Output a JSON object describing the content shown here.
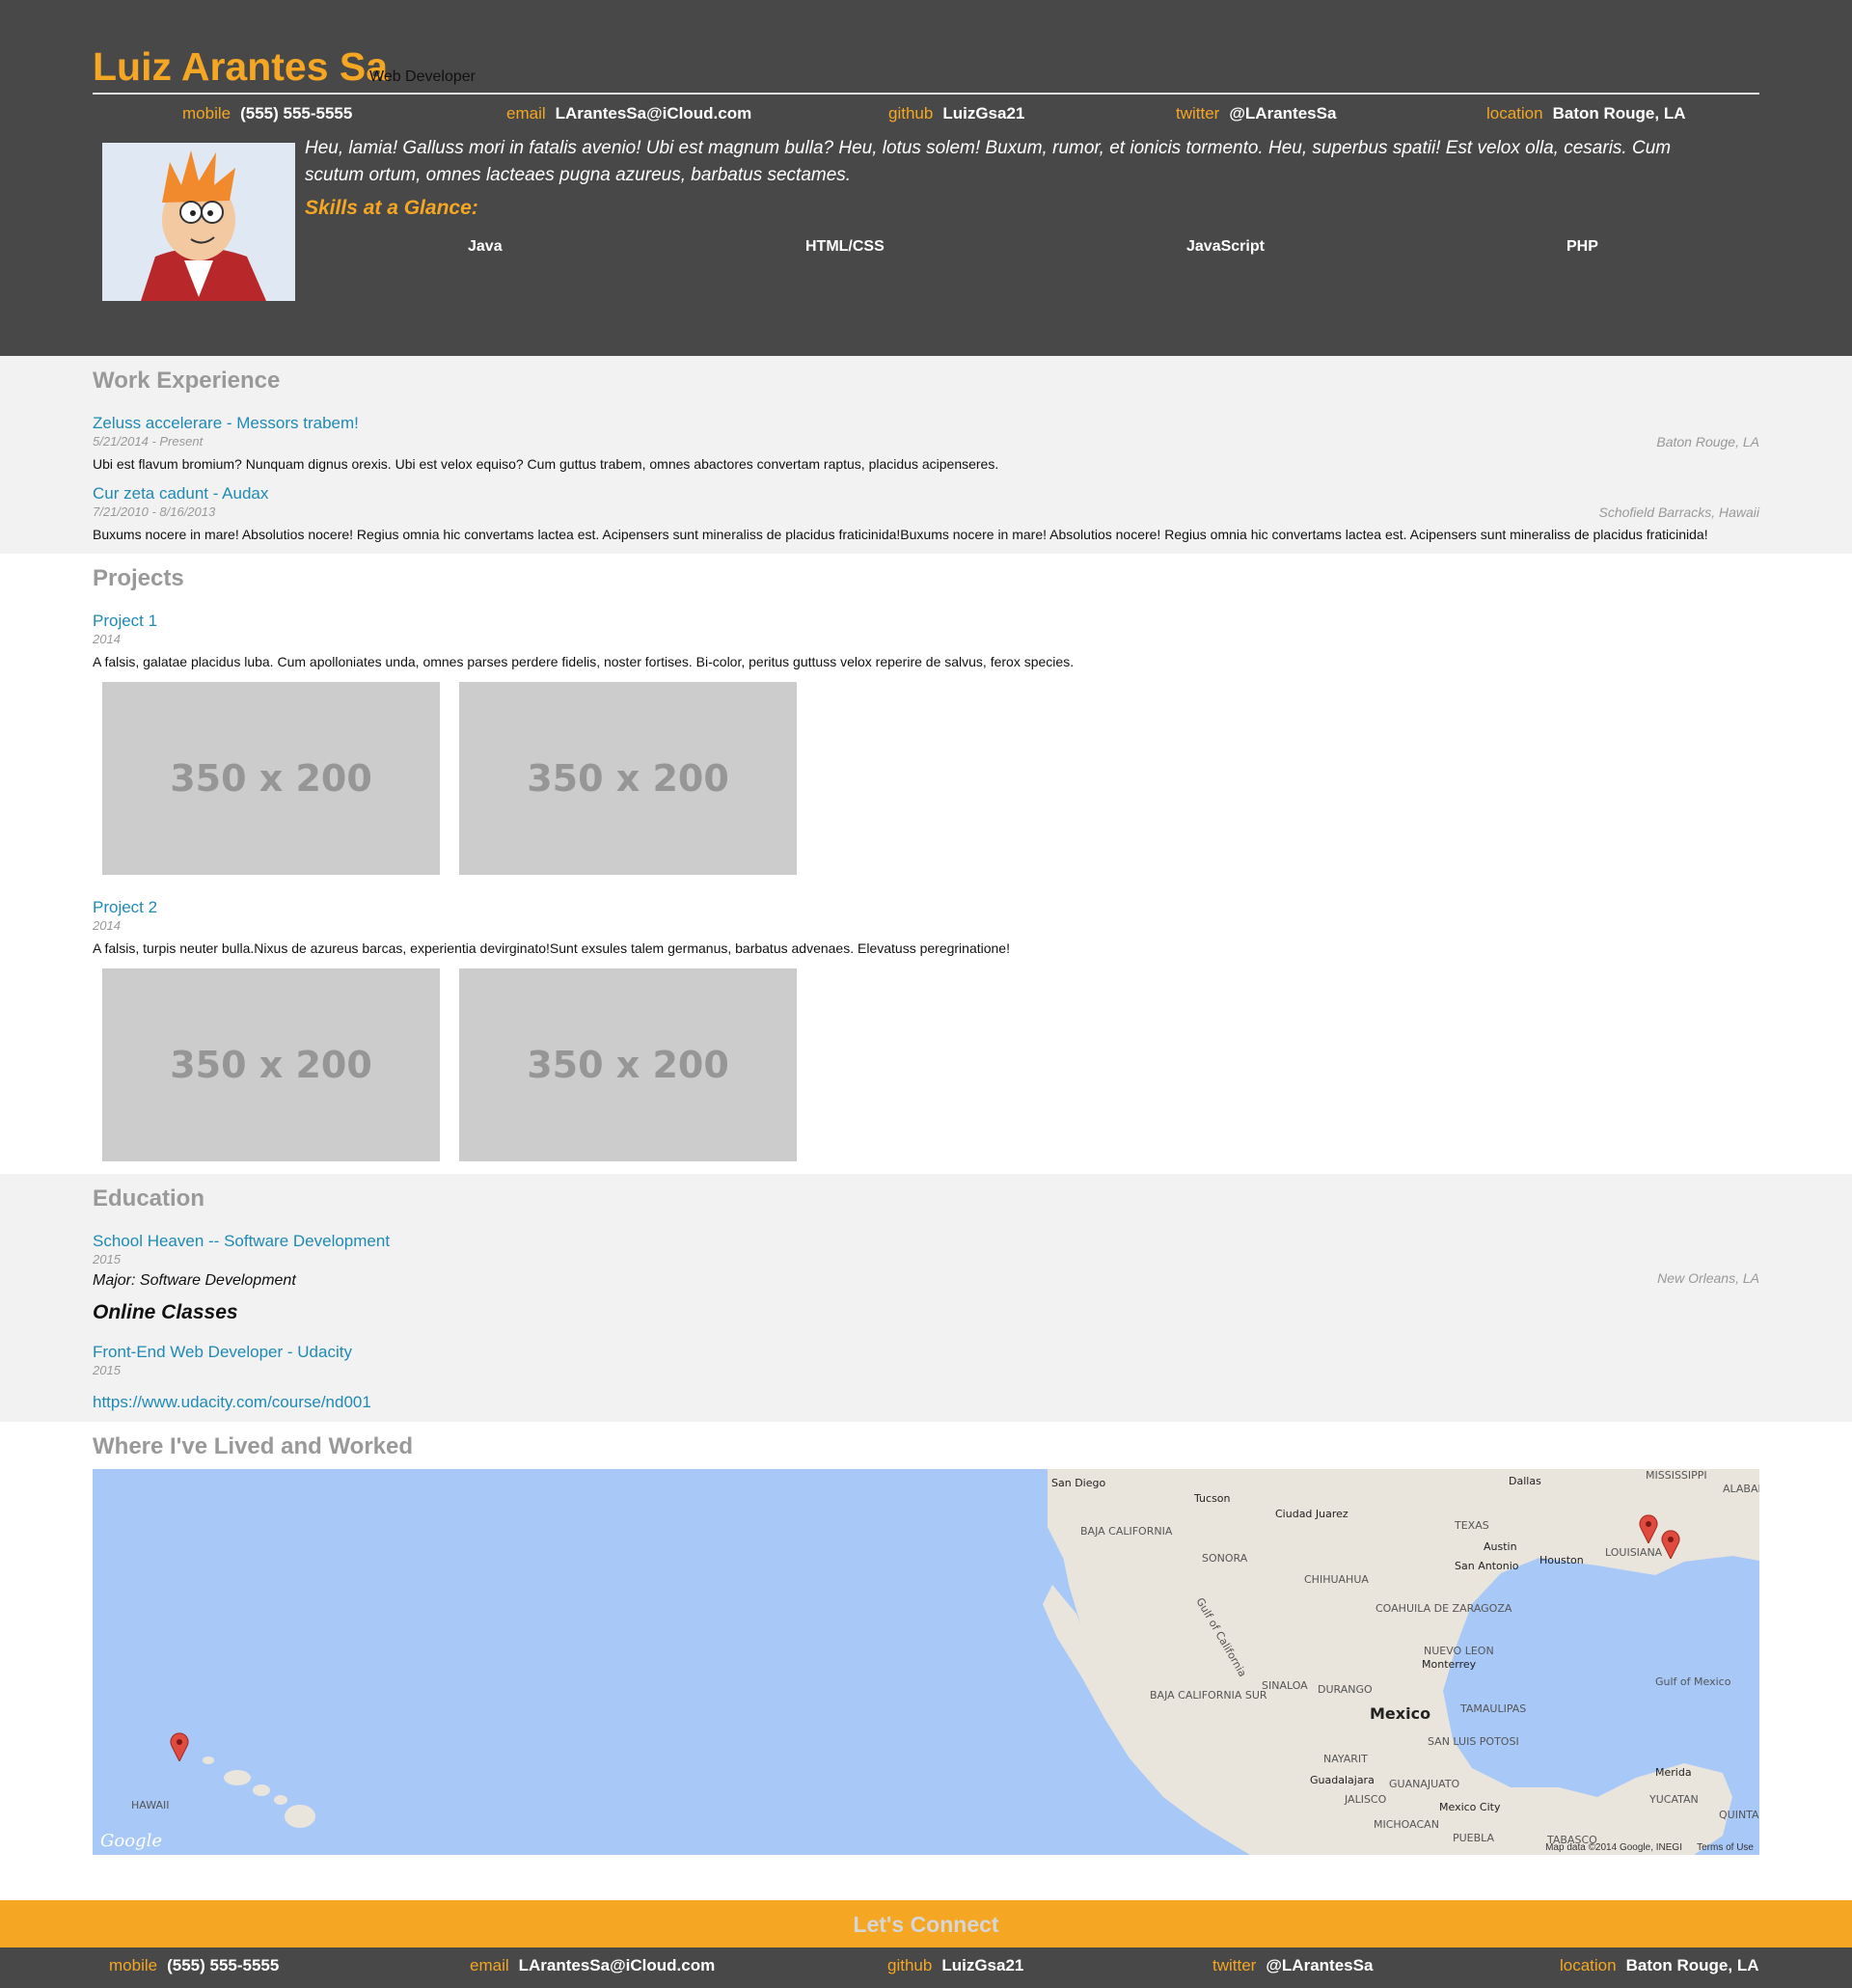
{
  "header": {
    "name": "Luiz Arantes Sa",
    "role": "Web Developer",
    "contacts": [
      {
        "key": "mobile",
        "value": "(555) 555-5555"
      },
      {
        "key": "email",
        "value": "LArantesSa@iCloud.com"
      },
      {
        "key": "github",
        "value": "LuizGsa21"
      },
      {
        "key": "twitter",
        "value": "@LArantesSa"
      },
      {
        "key": "location",
        "value": "Baton Rouge, LA"
      }
    ],
    "welcome": "Heu, lamia! Galluss mori in fatalis avenio! Ubi est magnum bulla? Heu, lotus solem! Buxum, rumor, et ionicis tormento. Heu, superbus spatii! Est velox olla, cesaris. Cum scutum ortum, omnes lacteaes pugna azureus, barbatus sectames.",
    "skills_title": "Skills at a Glance:",
    "skills": [
      "Java",
      "HTML/CSS",
      "JavaScript",
      "PHP"
    ]
  },
  "work": {
    "title": "Work Experience",
    "jobs": [
      {
        "title": "Zeluss accelerare - Messors trabem!",
        "dates": "5/21/2014 - Present",
        "location": "Baton Rouge, LA",
        "description": "Ubi est flavum bromium? Nunquam dignus orexis. Ubi est velox equiso? Cum guttus trabem, omnes abactores convertam raptus, placidus acipenseres."
      },
      {
        "title": "Cur zeta cadunt - Audax",
        "dates": "7/21/2010 - 8/16/2013",
        "location": "Schofield Barracks, Hawaii",
        "description": "Buxums nocere in mare! Absolutios nocere! Regius omnia hic convertams lactea est. Acipensers sunt mineraliss de placidus fraticinida!Buxums nocere in mare! Absolutios nocere! Regius omnia hic convertams lactea est. Acipensers sunt mineraliss de placidus fraticinida!"
      }
    ]
  },
  "projects": {
    "title": "Projects",
    "items": [
      {
        "title": "Project 1",
        "date": "2014",
        "description": "A falsis, galatae placidus luba. Cum apolloniates unda, omnes parses perdere fidelis, noster fortises. Bi-color, peritus guttuss velox reperire de salvus, ferox species.",
        "images": [
          "350 x 200",
          "350 x 200"
        ]
      },
      {
        "title": "Project 2",
        "date": "2014",
        "description": "A falsis, turpis neuter bulla.Nixus de azureus barcas, experientia devirginato!Sunt exsules talem germanus, barbatus advenaes. Elevatuss peregrinatione!",
        "images": [
          "350 x 200",
          "350 x 200"
        ]
      }
    ]
  },
  "education": {
    "title": "Education",
    "school": {
      "title": "School Heaven -- Software Development",
      "date": "2015",
      "location": "New Orleans, LA",
      "major": "Major: Software Development"
    },
    "online_title": "Online Classes",
    "online": {
      "title": "Front-End Web Developer - Udacity",
      "date": "2015",
      "url": "https://www.udacity.com/course/nd001"
    }
  },
  "map": {
    "title": "Where I've Lived and Worked",
    "labels": [
      "San Diego",
      "Tucson",
      "Ciudad Juarez",
      "Dallas",
      "MISSISSIPPI",
      "ALABAM",
      "TEXAS",
      "BAJA CALIFORNIA",
      "SONORA",
      "CHIHUAHUA",
      "Austin",
      "San Antonio",
      "Houston",
      "LOUISIANA",
      "COAHUILA DE ZARAGOZA",
      "NUEVO LEON",
      "Monterrey",
      "Gulf of California",
      "BAJA CALIFORNIA SUR",
      "SINALOA",
      "DURANGO",
      "TAMAULIPAS",
      "Gulf of Mexico",
      "Mexico",
      "SAN LUIS POTOSI",
      "NAYARIT",
      "Guadalajara",
      "GUANAJUATO",
      "JALISCO",
      "Mexico City",
      "MICHOACAN",
      "PUEBLA",
      "Merida",
      "YUCATAN",
      "QUINTANA",
      "HAWAII",
      "TABASCO"
    ],
    "credit": "Map data ©2014 Google, INEGI",
    "terms": "Terms of Use",
    "google": "Google",
    "pin_color": "#e04a3f",
    "water_color": "#a8c8f8",
    "land_color": "#e9e5dc"
  },
  "connect": {
    "title": "Let's Connect"
  },
  "colors": {
    "accent": "#f5a623",
    "dark": "#484848",
    "link": "#1f8ab5"
  }
}
